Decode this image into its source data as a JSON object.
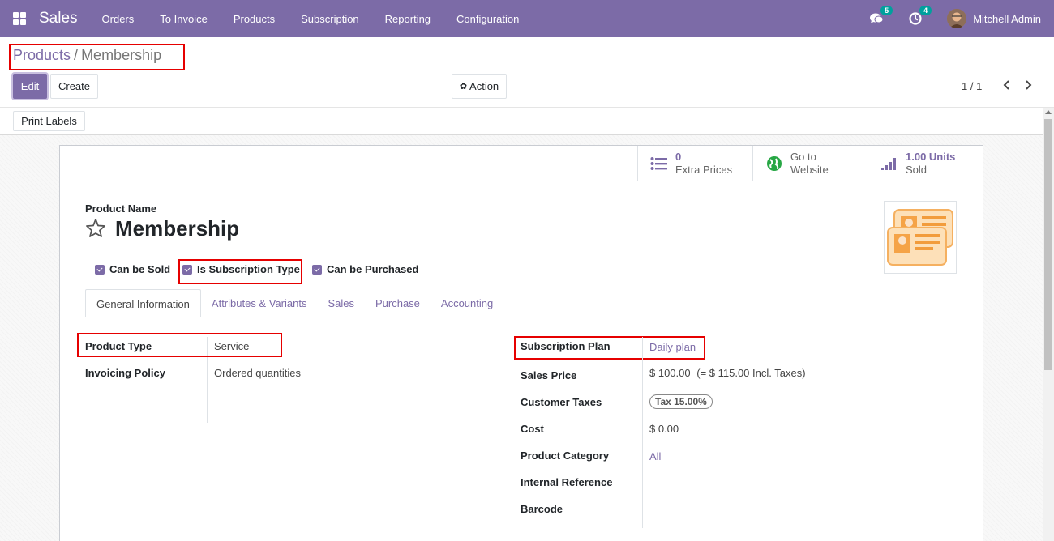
{
  "navbar": {
    "brand": "Sales",
    "menu": [
      "Orders",
      "To Invoice",
      "Products",
      "Subscription",
      "Reporting",
      "Configuration"
    ],
    "messages_count": "5",
    "activities_count": "4",
    "user_name": "Mitchell Admin",
    "color": "#7c6ba7"
  },
  "breadcrumb": {
    "parent": "Products",
    "separator": "/",
    "current": "Membership"
  },
  "toolbar": {
    "edit_label": "Edit",
    "create_label": "Create",
    "action_label": "Action",
    "pager": "1 / 1"
  },
  "statusbar": {
    "print_labels": "Print Labels"
  },
  "smart_buttons": [
    {
      "value": "0",
      "label": "Extra Prices",
      "icon": "list-icon"
    },
    {
      "value": "Go to",
      "label": "Website",
      "icon": "globe-icon"
    },
    {
      "value": "1.00 Units",
      "label": "Sold",
      "icon": "signal-icon"
    }
  ],
  "product": {
    "name_label": "Product Name",
    "name": "Membership",
    "checkboxes": [
      "Can be Sold",
      "Is Subscription Type",
      "Can be Purchased"
    ]
  },
  "tabs": [
    "General Information",
    "Attributes & Variants",
    "Sales",
    "Purchase",
    "Accounting"
  ],
  "left_fields": {
    "product_type_label": "Product Type",
    "product_type": "Service",
    "invoicing_policy_label": "Invoicing Policy",
    "invoicing_policy": "Ordered quantities"
  },
  "right_fields": {
    "subscription_plan_label": "Subscription Plan",
    "subscription_plan": "Daily plan",
    "sales_price_label": "Sales Price",
    "sales_price": "$ 100.00",
    "sales_price_incl": "(= $ 115.00 Incl. Taxes)",
    "customer_taxes_label": "Customer Taxes",
    "customer_taxes": "Tax 15.00%",
    "cost_label": "Cost",
    "cost": "$ 0.00",
    "category_label": "Product Category",
    "category": "All",
    "internal_ref_label": "Internal Reference",
    "barcode_label": "Barcode"
  }
}
